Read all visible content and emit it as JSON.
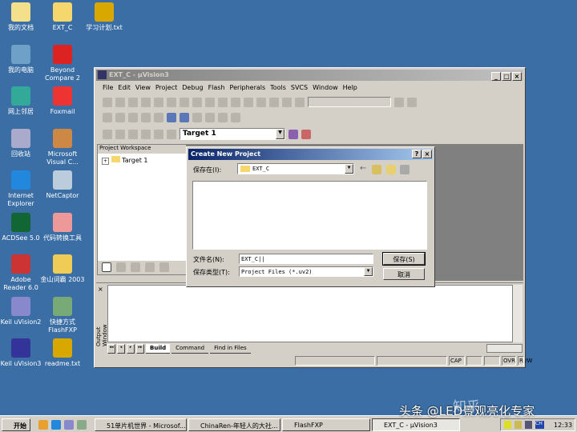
{
  "desktop": {
    "icons": [
      {
        "label": "我的文档",
        "color": "#f4e08a"
      },
      {
        "label": "EXT_C",
        "color": "#f5d76e"
      },
      {
        "label": "学习计划.txt",
        "color": "#d8a800"
      },
      {
        "label": "我的电脑",
        "color": "#6fa0c8"
      },
      {
        "label": "Beyond Compare 2",
        "color": "#d22"
      },
      {
        "label": "网上邻居",
        "color": "#3a9"
      },
      {
        "label": "Foxmail",
        "color": "#e33"
      },
      {
        "label": "回收站",
        "color": "#aac"
      },
      {
        "label": "Microsoft Visual C...",
        "color": "#c84"
      },
      {
        "label": "Internet Explorer",
        "color": "#28d"
      },
      {
        "label": "NetCaptor",
        "color": "#bcd"
      },
      {
        "label": "ACDSee 5.0",
        "color": "#163"
      },
      {
        "label": "代码转换工具",
        "color": "#e99"
      },
      {
        "label": "Adobe Reader 6.0",
        "color": "#c33"
      },
      {
        "label": "金山词霸 2003",
        "color": "#ec5"
      },
      {
        "label": "Keil uVision2",
        "color": "#88c"
      },
      {
        "label": "快捷方式 FlashFXP",
        "color": "#7a7"
      },
      {
        "label": "Keil uVision3",
        "color": "#339"
      },
      {
        "label": "readme.txt",
        "color": "#d8a800"
      }
    ]
  },
  "window": {
    "title": "EXT_C - µVision3",
    "menu": [
      "File",
      "Edit",
      "View",
      "Project",
      "Debug",
      "Flash",
      "Peripherals",
      "Tools",
      "SVCS",
      "Window",
      "Help"
    ],
    "target": "Target 1",
    "workspace": {
      "title": "Project Workspace",
      "tree_item": "Target 1"
    },
    "output": {
      "label": "Output Window",
      "tabs": [
        "Build",
        "Command",
        "Find in Files"
      ]
    },
    "status": [
      "CAP",
      "OVR",
      "R /W"
    ]
  },
  "dialog": {
    "title": "Create New Project",
    "help": "?",
    "close": "×",
    "save_in_label": "保存在(I):",
    "save_in_value": "EXT_C",
    "filename_label": "文件名(N):",
    "filename_value": "EXT_C",
    "filetype_label": "保存类型(T):",
    "filetype_value": "Project Files (*.uv2)",
    "save_button": "保存(S)",
    "cancel_button": "取消"
  },
  "taskbar": {
    "start": "开始",
    "tasks": [
      "51单片机世界 - Microsof...",
      "ChinaRen-年轻人的大社...",
      "FlashFXP",
      "EXT_C - µVision3"
    ],
    "tray_ime": "CH",
    "clock": "12:33"
  },
  "watermark": "头条 @LED景观亮化专家",
  "watermark2": "知乎"
}
